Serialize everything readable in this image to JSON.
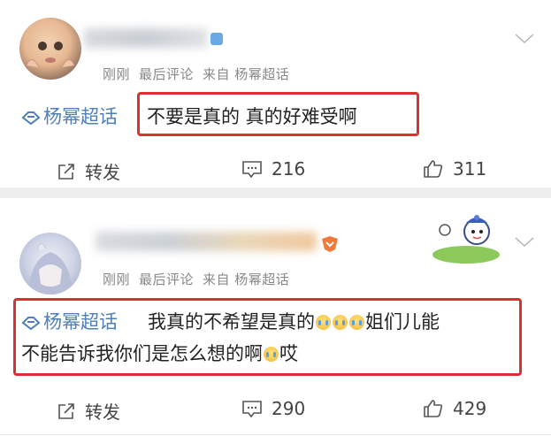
{
  "posts": [
    {
      "meta": {
        "time": "刚刚",
        "sort": "最后评论",
        "source": "来自 杨幂超话"
      },
      "topic": "杨幂超话",
      "comment": [
        "不要是真的 真的好难受啊"
      ],
      "actions": {
        "repost_label": "转发",
        "comments": "216",
        "likes": "311"
      }
    },
    {
      "meta": {
        "time": "刚刚",
        "sort": "最后评论",
        "source": "来自 杨幂超话"
      },
      "topic": "杨幂超话",
      "comment": [
        "我真的不希望是真的",
        "姐们儿能",
        "不能告诉我你们是怎么想的啊",
        "哎"
      ],
      "actions": {
        "repost_label": "转发",
        "comments": "290",
        "likes": "429"
      }
    }
  ],
  "colors": {
    "highlight_border": "#d93030",
    "topic_link": "#4d7fb8",
    "meta_text": "#888888",
    "divider": "#eeeeee"
  },
  "icons": [
    "dropdown-chevron-icon",
    "supertopic-icon",
    "repost-icon",
    "comment-icon",
    "like-icon",
    "crying-emoji-icon",
    "rank-badge-icon"
  ]
}
